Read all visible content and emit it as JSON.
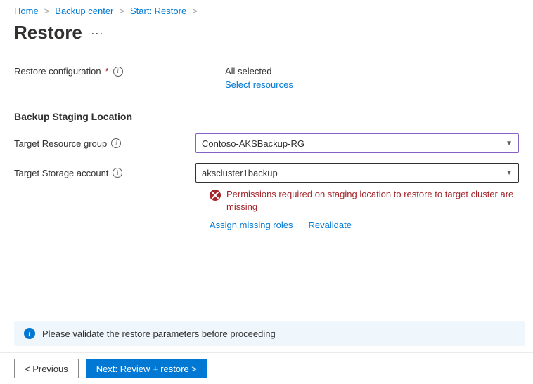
{
  "breadcrumbs": {
    "items": [
      "Home",
      "Backup center",
      "Start: Restore"
    ],
    "sep": ">"
  },
  "page": {
    "title": "Restore",
    "more_label": "···"
  },
  "restore_config": {
    "label": "Restore configuration",
    "status": "All selected",
    "link": "Select resources"
  },
  "section": {
    "heading": "Backup Staging Location"
  },
  "form": {
    "resource_group": {
      "label": "Target Resource group",
      "value": "Contoso-AKSBackup-RG"
    },
    "storage_account": {
      "label": "Target Storage account",
      "value": "akscluster1backup"
    }
  },
  "error": {
    "message": "Permissions required on staging location to restore to target cluster are missing",
    "assign_link": "Assign missing roles",
    "revalidate_link": "Revalidate"
  },
  "notice": {
    "text": "Please validate the restore parameters before proceeding"
  },
  "footer": {
    "previous": "< Previous",
    "next": "Next: Review + restore >"
  },
  "glyph": {
    "info": "i"
  }
}
